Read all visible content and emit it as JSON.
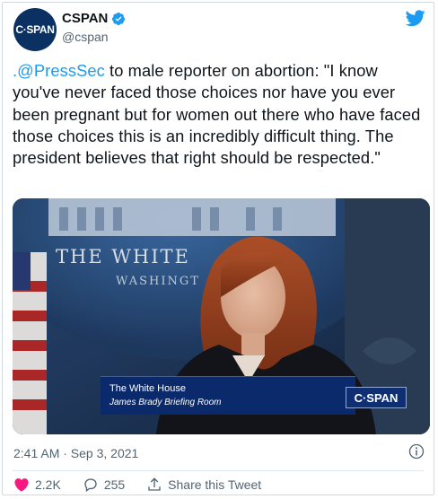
{
  "account": {
    "avatar_text": "C·SPAN",
    "name": "CSPAN",
    "handle": "@cspan"
  },
  "tweet": {
    "mention": ".@PressSec",
    "body": " to male reporter on abortion: \"I know you've never faced those choices nor have you ever been pregnant but for women out there who have faced those choices this is an incredibly difficult thing. The president believes that right should be respected.\""
  },
  "media": {
    "wall_text_1": "THE WHITE",
    "wall_text_2": "WASHINGT",
    "lower_third_title": "The White House",
    "lower_third_subtitle": "James Brady Briefing Room",
    "network_bug": "C·SPAN"
  },
  "footer": {
    "timestamp": "2:41 AM · Sep 3, 2021",
    "likes": "2.2K",
    "replies": "255",
    "share_label": "Share this Tweet"
  },
  "colors": {
    "accent": "#1d9bf0",
    "text": "#0f1419",
    "muted": "#536471",
    "like_red": "#f91880"
  },
  "icons": [
    "verified-badge-icon",
    "twitter-bird-icon",
    "info-icon",
    "heart-icon",
    "reply-icon",
    "share-icon"
  ]
}
